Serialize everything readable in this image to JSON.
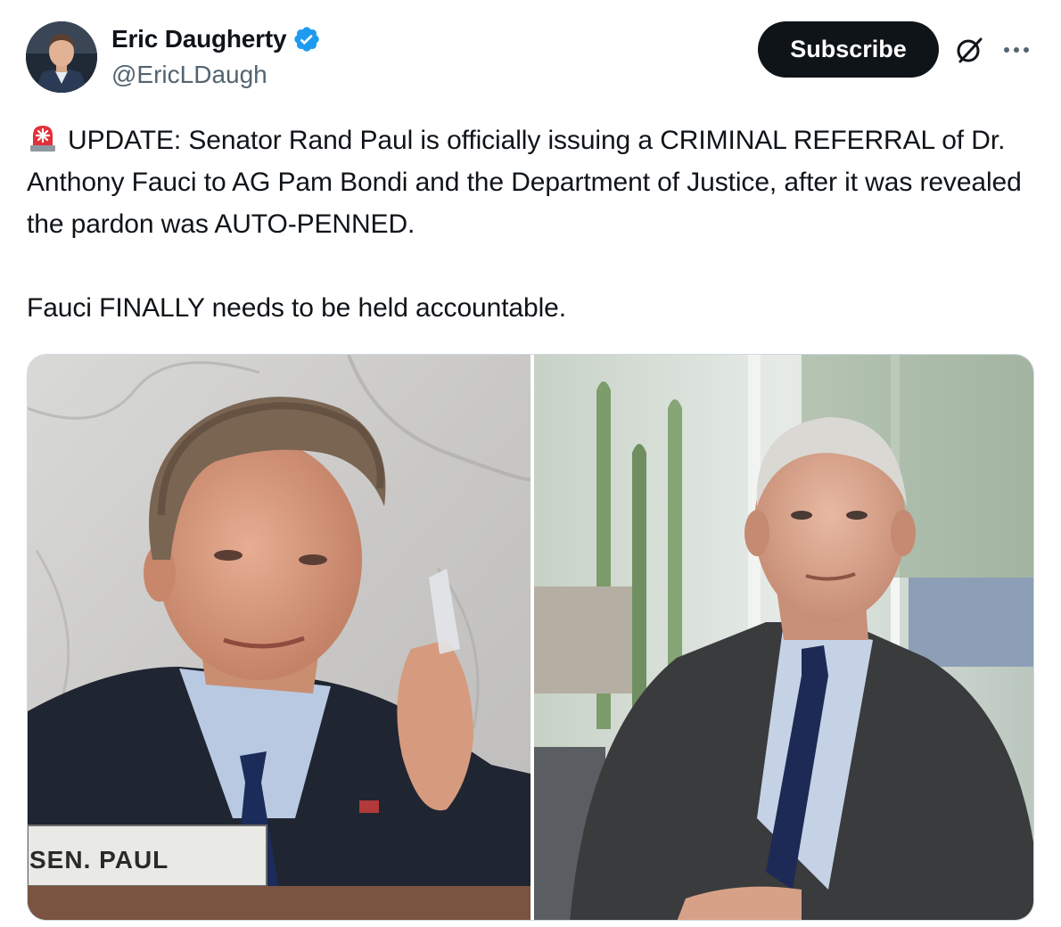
{
  "author": {
    "display_name": "Eric Daugherty",
    "handle": "@EricLDaugh",
    "verified": true
  },
  "actions": {
    "subscribe_label": "Subscribe",
    "grok_icon": "slashed-circle-icon",
    "more_icon": "more-dots-icon"
  },
  "tweet": {
    "emoji_icon": "siren-icon",
    "line1": "UPDATE: Senator Rand Paul is officially issuing a CRIMINAL REFERRAL of Dr. Anthony Fauci to AG Pam Bondi and the Department of Justice, after it was revealed the pardon was AUTO-PENNED.",
    "line2": "Fauci FINALLY needs to be held accountable."
  },
  "media": {
    "left_photo": {
      "nameplate_text": "SEN. PAUL"
    },
    "right_photo": {}
  },
  "colors": {
    "text": "#0f1419",
    "secondary_text": "#536471",
    "verified_blue": "#1d9bf0",
    "button_bg": "#0f1419"
  }
}
